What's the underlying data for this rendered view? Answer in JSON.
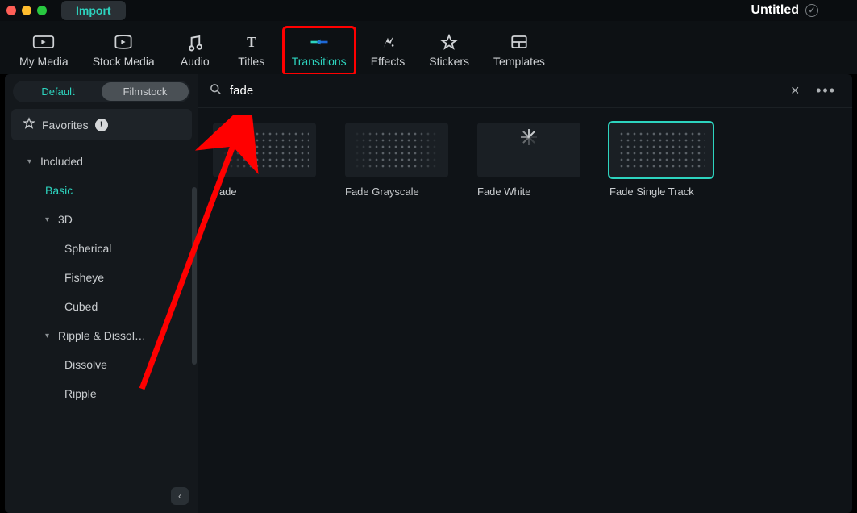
{
  "titlebar": {
    "import_label": "Import",
    "project_title": "Untitled"
  },
  "toptabs": [
    {
      "id": "my-media",
      "label": "My Media",
      "active": false
    },
    {
      "id": "stock-media",
      "label": "Stock Media",
      "active": false
    },
    {
      "id": "audio",
      "label": "Audio",
      "active": false
    },
    {
      "id": "titles",
      "label": "Titles",
      "active": false
    },
    {
      "id": "transitions",
      "label": "Transitions",
      "active": true
    },
    {
      "id": "effects",
      "label": "Effects",
      "active": false
    },
    {
      "id": "stickers",
      "label": "Stickers",
      "active": false
    },
    {
      "id": "templates",
      "label": "Templates",
      "active": false
    }
  ],
  "sidebar": {
    "pills": {
      "default": "Default",
      "filmstock": "Filmstock",
      "active": "default"
    },
    "favorites_label": "Favorites",
    "favorites_badge": "!",
    "tree": [
      {
        "label": "Included",
        "level": 1,
        "caret": "▾"
      },
      {
        "label": "Basic",
        "level": 2,
        "active": true
      },
      {
        "label": "3D",
        "level": 2,
        "caret": "▾"
      },
      {
        "label": "Spherical",
        "level": 3
      },
      {
        "label": "Fisheye",
        "level": 3
      },
      {
        "label": "Cubed",
        "level": 3
      },
      {
        "label": "Ripple & Dissol…",
        "level": 2,
        "caret": "▾"
      },
      {
        "label": "Dissolve",
        "level": 3
      },
      {
        "label": "Ripple",
        "level": 3
      }
    ]
  },
  "search": {
    "query": "fade",
    "clear_symbol": "✕",
    "more_symbol": "•••"
  },
  "results": [
    {
      "id": "fade",
      "label": "Fade",
      "thumb": "dot-fade-left",
      "selected": false
    },
    {
      "id": "fade-grayscale",
      "label": "Fade Grayscale",
      "thumb": "dot-fade-both",
      "selected": false
    },
    {
      "id": "fade-white",
      "label": "Fade White",
      "thumb": "spinner",
      "selected": false
    },
    {
      "id": "fade-single-track",
      "label": "Fade Single Track",
      "thumb": "dot-plain",
      "selected": true
    }
  ],
  "colors": {
    "accent": "#2dd4bf",
    "highlight": "#ff0000",
    "bg": "#0d1114"
  }
}
